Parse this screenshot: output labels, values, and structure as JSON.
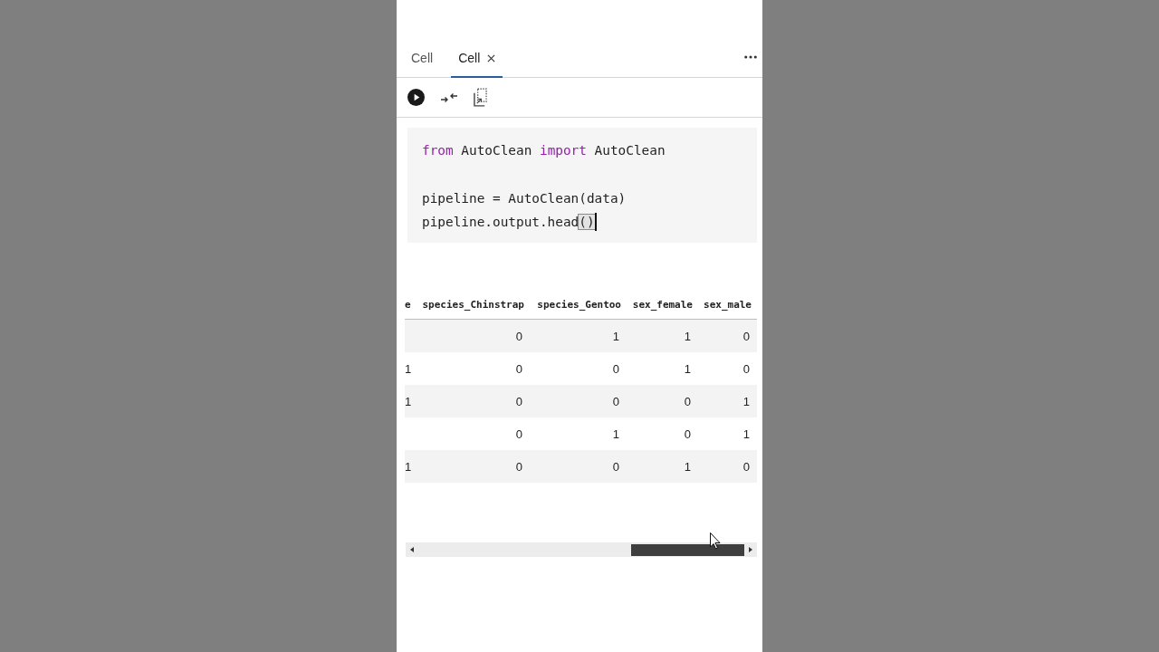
{
  "tabs": [
    {
      "label": "Cell",
      "selected": false,
      "closable": false
    },
    {
      "label": "Cell",
      "selected": true,
      "closable": true
    }
  ],
  "code_cell": {
    "lines": [
      {
        "kind": "code",
        "cursor": false,
        "tokens": [
          {
            "kind": "keyword",
            "text": "from"
          },
          {
            "kind": "plain",
            "text": " AutoClean "
          },
          {
            "kind": "keyword",
            "text": "import"
          },
          {
            "kind": "plain",
            "text": " AutoClean"
          }
        ]
      },
      {
        "kind": "blank"
      },
      {
        "kind": "code",
        "cursor": false,
        "tokens": [
          {
            "kind": "plain",
            "text": "pipeline = AutoClean(data)"
          }
        ]
      },
      {
        "kind": "code",
        "cursor": true,
        "tokens": [
          {
            "kind": "plain",
            "text": "pipeline.output.head"
          },
          {
            "kind": "matched_brackets",
            "text": "()"
          }
        ]
      }
    ]
  },
  "output_table": {
    "partial_column": {
      "header": "e"
    },
    "columns": [
      "species_Chinstrap",
      "species_Gentoo",
      "sex_female",
      "sex_male"
    ],
    "rows": [
      {
        "cells": [
          "0",
          "1",
          "1",
          "0"
        ]
      },
      {
        "partial_cell": "1",
        "cells": [
          "0",
          "0",
          "1",
          "0"
        ]
      },
      {
        "partial_cell": "1",
        "cells": [
          "0",
          "0",
          "0",
          "1"
        ]
      },
      {
        "cells": [
          "0",
          "1",
          "0",
          "1"
        ]
      },
      {
        "partial_cell": "1",
        "cells": [
          "0",
          "0",
          "1",
          "0"
        ]
      }
    ]
  }
}
